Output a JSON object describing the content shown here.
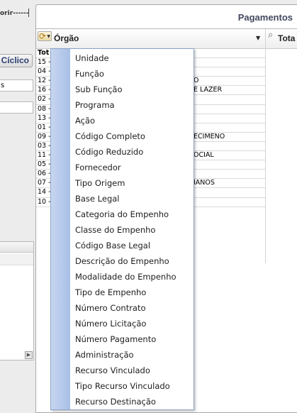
{
  "left": {
    "top_text": "orir------",
    "ciclico_button": "Cíclico",
    "field_1": "s",
    "field_2": ""
  },
  "panel": {
    "title": "Pagamentos",
    "column_dimension": "Órgão",
    "column_total": "Tota"
  },
  "rows": [
    {
      "code": "Tot",
      "name": "",
      "bold": true
    },
    {
      "code": "15 -",
      "name": ""
    },
    {
      "code": "04 -",
      "name": ""
    },
    {
      "code": "12 -",
      "name": "O"
    },
    {
      "code": "16 -",
      "name": "E LAZER"
    },
    {
      "code": "02 -",
      "name": ""
    },
    {
      "code": "08 -",
      "name": ""
    },
    {
      "code": "13 -",
      "name": ""
    },
    {
      "code": "01 -",
      "name": ""
    },
    {
      "code": "09 -",
      "name": "ECIMENO"
    },
    {
      "code": "03 -",
      "name": ""
    },
    {
      "code": "11 -",
      "name": "OCIAL"
    },
    {
      "code": "05 -",
      "name": ""
    },
    {
      "code": "06 -",
      "name": ""
    },
    {
      "code": "07 -",
      "name": "IANOS"
    },
    {
      "code": "14 -",
      "name": ""
    },
    {
      "code": "10 -",
      "name": ""
    }
  ],
  "menu": {
    "items": [
      "Unidade",
      "Função",
      "Sub Função",
      "Programa",
      "Ação",
      "Código Completo",
      "Código Reduzido",
      "Fornecedor",
      "Tipo Origem",
      "Base Legal",
      "Categoria do Empenho",
      "Classe do Empenho",
      "Código Base Legal",
      "Descrição do Empenho",
      "Modalidade do Empenho",
      "Tipo de Empenho",
      "Número Contrato",
      "Número Licitação",
      "Número Pagamento",
      "Administração",
      "Recurso Vinculado",
      "Tipo Recurso Vinculado",
      "Recurso Destinação"
    ]
  },
  "icons": {
    "dimension": "pivot-dimension-icon",
    "total": "zoom-icon",
    "scroll": "arrow-right-icon"
  }
}
